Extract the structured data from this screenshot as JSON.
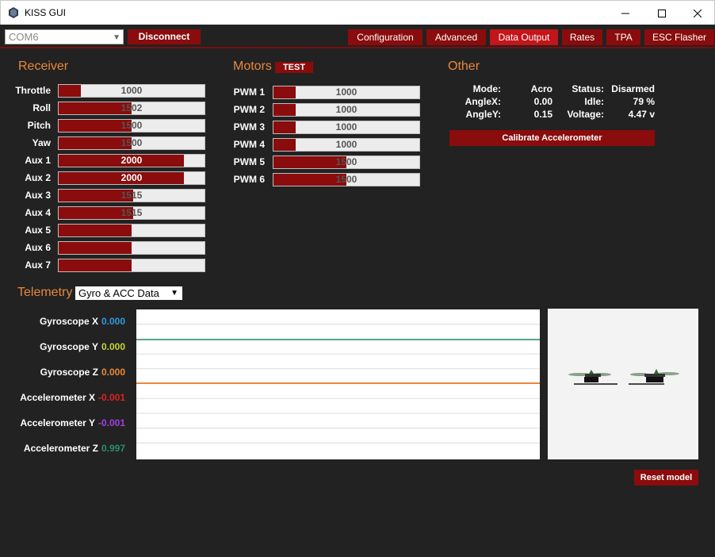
{
  "window": {
    "title": "KISS GUI"
  },
  "toolbar": {
    "port_value": "COM6",
    "disconnect_label": "Disconnect",
    "tabs": [
      {
        "label": "Configuration"
      },
      {
        "label": "Advanced"
      },
      {
        "label": "Data Output",
        "active": true
      },
      {
        "label": "Rates"
      },
      {
        "label": "TPA"
      },
      {
        "label": "ESC Flasher"
      }
    ]
  },
  "receiver": {
    "title": "Receiver",
    "channels": [
      {
        "label": "Throttle",
        "value": "1000",
        "fill": 0.15
      },
      {
        "label": "Roll",
        "value": "1502",
        "fill": 0.5
      },
      {
        "label": "Pitch",
        "value": "1500",
        "fill": 0.5
      },
      {
        "label": "Yaw",
        "value": "1500",
        "fill": 0.5
      },
      {
        "label": "Aux 1",
        "value": "2000",
        "fill": 0.86
      },
      {
        "label": "Aux 2",
        "value": "2000",
        "fill": 0.86
      },
      {
        "label": "Aux 3",
        "value": "1515",
        "fill": 0.51
      },
      {
        "label": "Aux 4",
        "value": "1515",
        "fill": 0.51
      },
      {
        "label": "Aux 5",
        "value": "",
        "fill": 0.5
      },
      {
        "label": "Aux 6",
        "value": "",
        "fill": 0.5
      },
      {
        "label": "Aux 7",
        "value": "",
        "fill": 0.5
      }
    ]
  },
  "motors": {
    "title": "Motors",
    "test_label": "TEST",
    "channels": [
      {
        "label": "PWM 1",
        "value": "1000",
        "fill": 0.15
      },
      {
        "label": "PWM 2",
        "value": "1000",
        "fill": 0.15
      },
      {
        "label": "PWM 3",
        "value": "1000",
        "fill": 0.15
      },
      {
        "label": "PWM 4",
        "value": "1000",
        "fill": 0.15
      },
      {
        "label": "PWM 5",
        "value": "1500",
        "fill": 0.5
      },
      {
        "label": "PWM 6",
        "value": "1500",
        "fill": 0.5
      }
    ]
  },
  "other": {
    "title": "Other",
    "mode_label": "Mode:",
    "mode_value": "Acro",
    "status_label": "Status:",
    "status_value": "Disarmed",
    "anglex_label": "AngleX:",
    "anglex_value": "0.00",
    "idle_label": "Idle:",
    "idle_value": "79 %",
    "angley_label": "AngleY:",
    "angley_value": "0.15",
    "voltage_label": "Voltage:",
    "voltage_value": "4.47 v",
    "calibrate_label": "Calibrate Accelerometer"
  },
  "telemetry": {
    "title": "Telemetry",
    "selected": "Gyro & ACC Data",
    "reset_label": "Reset model",
    "series": [
      {
        "label": "Gyroscope X",
        "value": "0.000",
        "color": "#2e9be0"
      },
      {
        "label": "Gyroscope Y",
        "value": "0.000",
        "color": "#c8d63a"
      },
      {
        "label": "Gyroscope Z",
        "value": "0.000",
        "color": "#e9883b"
      },
      {
        "label": "Accelerometer X",
        "value": "-0.001",
        "color": "#e02020"
      },
      {
        "label": "Accelerometer Y",
        "value": "-0.001",
        "color": "#a040e0"
      },
      {
        "label": "Accelerometer Z",
        "value": "0.997",
        "color": "#2a8f6a"
      }
    ]
  },
  "colors": {
    "accent": "#e9883b",
    "button": "#8a0c0c",
    "active_tab": "#c3151a",
    "background": "#222222"
  }
}
